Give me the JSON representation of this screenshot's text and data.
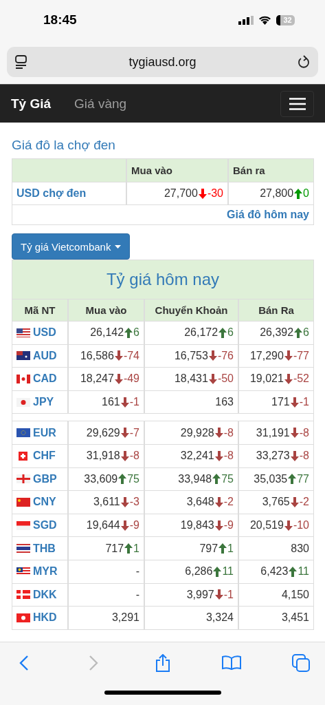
{
  "status_bar": {
    "time": "18:45",
    "battery": "32"
  },
  "browser": {
    "url": "tygiausd.org"
  },
  "nav": {
    "tabs": [
      {
        "label": "Tỷ Giá",
        "selected": true
      },
      {
        "label": "Giá vàng",
        "selected": false
      }
    ]
  },
  "black_market": {
    "title": "Giá đô la chợ đen",
    "columns": [
      "Mua vào",
      "Bán ra"
    ],
    "row": {
      "label": "USD chợ đen",
      "buy": {
        "value": "27,700",
        "rising": false,
        "change": "-30"
      },
      "sell": {
        "value": "27,800",
        "rising": true,
        "change": "0"
      }
    },
    "link": "Giá đô hôm nay"
  },
  "bank_button": {
    "label": "Tỷ giá Vietcombank"
  },
  "rates": {
    "title": "Tỷ giá hôm nay",
    "columns": [
      "Mã NT",
      "Mua vào",
      "Chuyển Khoản",
      "Bán Ra"
    ],
    "rows": [
      {
        "kind": "currency",
        "code": "USD",
        "buy": {
          "value": "26,142",
          "rising": true,
          "change": "6"
        },
        "transfer": {
          "value": "26,172",
          "rising": true,
          "change": "6"
        },
        "sell": {
          "value": "26,392",
          "rising": true,
          "change": "6"
        }
      },
      {
        "kind": "currency",
        "code": "AUD",
        "buy": {
          "value": "16,586",
          "rising": false,
          "change": "-74"
        },
        "transfer": {
          "value": "16,753",
          "rising": false,
          "change": "-76"
        },
        "sell": {
          "value": "17,290",
          "rising": false,
          "change": "-77"
        }
      },
      {
        "kind": "currency",
        "code": "CAD",
        "buy": {
          "value": "18,247",
          "rising": false,
          "change": "-49"
        },
        "transfer": {
          "value": "18,431",
          "rising": false,
          "change": "-50"
        },
        "sell": {
          "value": "19,021",
          "rising": false,
          "change": "-52"
        }
      },
      {
        "kind": "currency",
        "code": "JPY",
        "buy": {
          "value": "161",
          "rising": false,
          "change": "-1"
        },
        "transfer": {
          "value": "163"
        },
        "sell": {
          "value": "171",
          "rising": false,
          "change": "-1"
        }
      },
      {
        "kind": "gap"
      },
      {
        "kind": "currency",
        "code": "EUR",
        "buy": {
          "value": "29,629",
          "rising": false,
          "change": "-7"
        },
        "transfer": {
          "value": "29,928",
          "rising": false,
          "change": "-8"
        },
        "sell": {
          "value": "31,191",
          "rising": false,
          "change": "-8"
        }
      },
      {
        "kind": "currency",
        "code": "CHF",
        "buy": {
          "value": "31,918",
          "rising": false,
          "change": "-8"
        },
        "transfer": {
          "value": "32,241",
          "rising": false,
          "change": "-8"
        },
        "sell": {
          "value": "33,273",
          "rising": false,
          "change": "-8"
        }
      },
      {
        "kind": "currency",
        "code": "GBP",
        "buy": {
          "value": "33,609",
          "rising": true,
          "change": "75"
        },
        "transfer": {
          "value": "33,948",
          "rising": true,
          "change": "75"
        },
        "sell": {
          "value": "35,035",
          "rising": true,
          "change": "77"
        }
      },
      {
        "kind": "currency",
        "code": "CNY",
        "buy": {
          "value": "3,611",
          "rising": false,
          "change": "-3"
        },
        "transfer": {
          "value": "3,648",
          "rising": false,
          "change": "-2"
        },
        "sell": {
          "value": "3,765",
          "rising": false,
          "change": "-2"
        }
      },
      {
        "kind": "currency",
        "code": "SGD",
        "buy": {
          "value": "19,644",
          "rising": false,
          "change": "-9"
        },
        "transfer": {
          "value": "19,843",
          "rising": false,
          "change": "-9"
        },
        "sell": {
          "value": "20,519",
          "rising": false,
          "change": "-10"
        }
      },
      {
        "kind": "currency",
        "code": "THB",
        "buy": {
          "value": "717",
          "rising": true,
          "change": "1"
        },
        "transfer": {
          "value": "797",
          "rising": true,
          "change": "1"
        },
        "sell": {
          "value": "830"
        }
      },
      {
        "kind": "currency",
        "code": "MYR",
        "buy": {
          "value": "-"
        },
        "transfer": {
          "value": "6,286",
          "rising": true,
          "change": "11"
        },
        "sell": {
          "value": "6,423",
          "rising": true,
          "change": "11"
        }
      },
      {
        "kind": "currency",
        "code": "DKK",
        "buy": {
          "value": "-"
        },
        "transfer": {
          "value": "3,997",
          "rising": false,
          "change": "-1"
        },
        "sell": {
          "value": "4,150"
        }
      },
      {
        "kind": "currency",
        "code": "HKD",
        "buy": {
          "value": "3,291"
        },
        "transfer": {
          "value": "3,324"
        },
        "sell": {
          "value": "3,451"
        }
      }
    ]
  },
  "toolbar": {
    "forward_disabled": true
  }
}
